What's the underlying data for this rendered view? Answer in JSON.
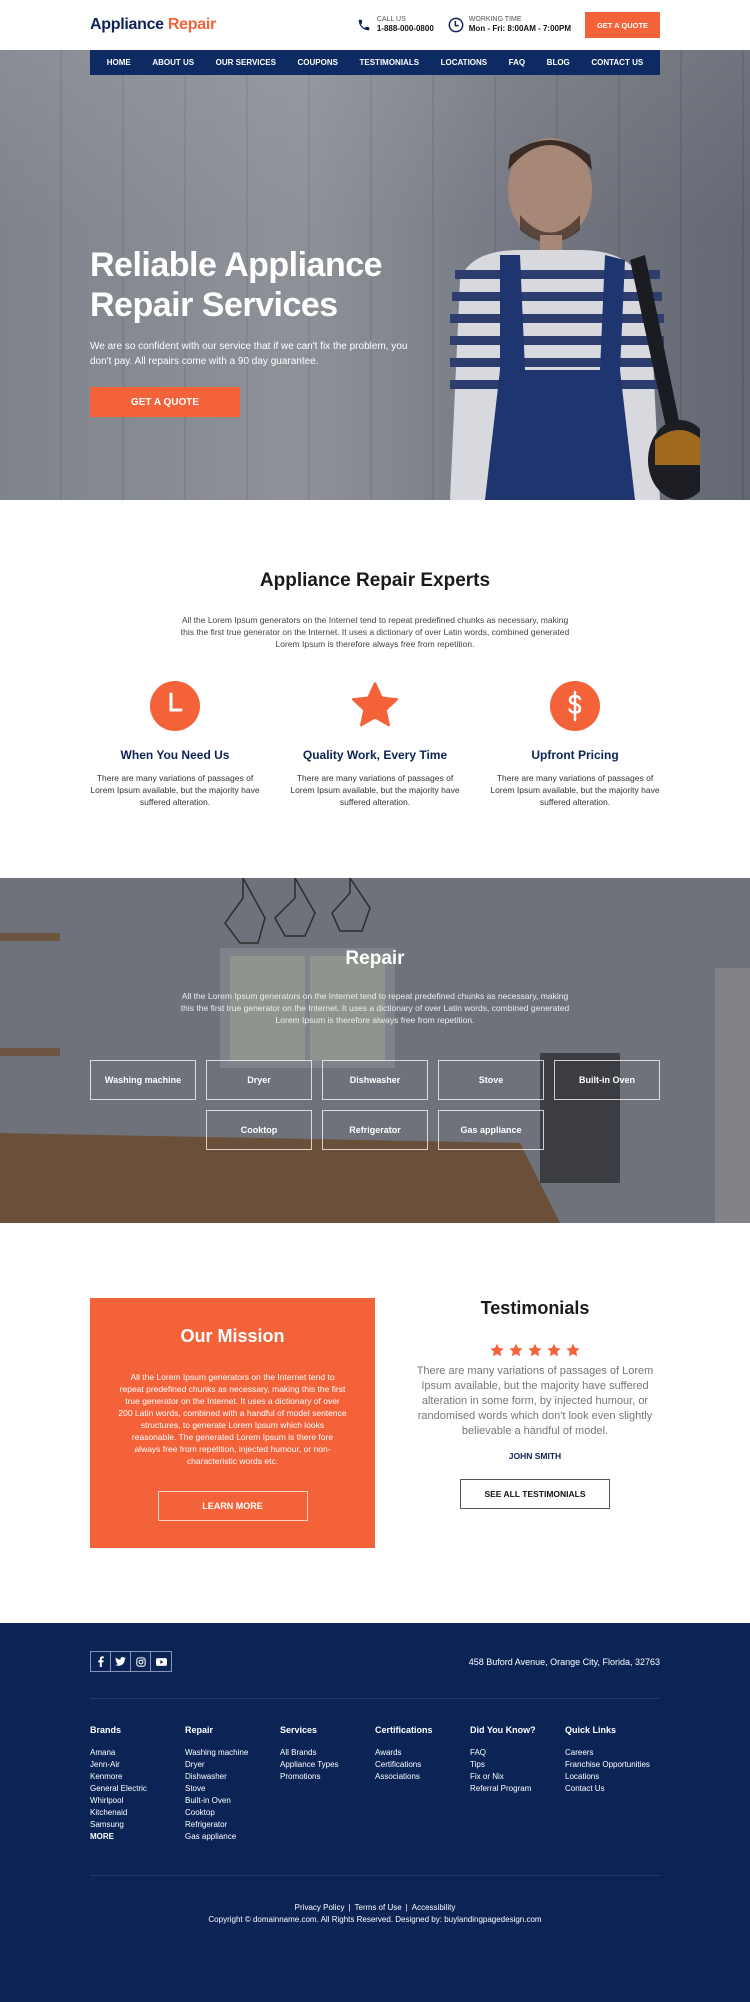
{
  "header": {
    "logo_part1": "Appliance",
    "logo_part2": "Repair",
    "call_label": "CALL US",
    "call_value": "1-888-000-0800",
    "hours_label": "WORKING TIME",
    "hours_value": "Mon - Fri: 8:00AM - 7:00PM",
    "quote_button": "GET A QUOTE"
  },
  "nav": [
    "HOME",
    "ABOUT US",
    "OUR SERVICES",
    "COUPONS",
    "TESTIMONIALS",
    "LOCATIONS",
    "FAQ",
    "BLOG",
    "CONTACT US"
  ],
  "hero": {
    "title_line1": "Reliable Appliance",
    "title_line2": "Repair Services",
    "subtitle": "We are so confident with our service that if we can't fix the problem, you don't pay. All repairs come with a 90 day guarantee.",
    "button": "GET A QUOTE"
  },
  "experts": {
    "title": "Appliance Repair Experts",
    "intro": "All the Lorem Ipsum generators on the Internet tend to repeat predefined chunks as necessary, making this the first true generator on the Internet. It uses a dictionary of over Latin words, combined generated Lorem Ipsum is therefore always free from repetition.",
    "features": [
      {
        "icon": "clock-icon",
        "title": "When You Need Us",
        "text": "There are many variations of passages of Lorem Ipsum available, but the majority have suffered alteration."
      },
      {
        "icon": "star-icon",
        "title": "Quality Work, Every Time",
        "text": "There are many variations of passages of Lorem Ipsum available, but the majority have suffered alteration."
      },
      {
        "icon": "dollar-icon",
        "title": "Upfront Pricing",
        "text": "There are many variations of passages of Lorem Ipsum available, but the majority have suffered alteration."
      }
    ]
  },
  "repair": {
    "title": "Repair",
    "intro": "All the Lorem Ipsum generators on the Internet tend to repeat predefined chunks as necessary, making this the first true generator on the Internet. It uses a dictionary of over Latin words, combined generated Lorem Ipsum is therefore always free from repetition.",
    "items": [
      "Washing machine",
      "Dryer",
      "Dishwasher",
      "Stove",
      "Built-in Oven",
      "Cooktop",
      "Refrigerator",
      "Gas appliance"
    ]
  },
  "mission": {
    "title": "Our Mission",
    "text": "All the Lorem Ipsum generators on the Internet tend to repeat predefined chunks as necessary, making this the first true generator on the Internet. It uses a dictionary of over 200 Latin words, combined with a handful of model sentence structures, to generate Lorem Ipsum which looks reasonable. The generated Lorem Ipsum is there fore always free from repetition, injected humour, or non-characteristic words etc.",
    "button": "LEARN MORE"
  },
  "testimonials": {
    "title": "Testimonials",
    "rating": 5,
    "rating_max": 5,
    "quote": "There are many variations of passages of Lorem Ipsum available, but the majority have suffered alteration in some form, by injected humour, or randomised words which don't look even slightly believable a handful of model.",
    "author": "JOHN SMITH",
    "button": "SEE ALL TESTIMONIALS"
  },
  "footer": {
    "social": [
      "facebook-icon",
      "twitter-icon",
      "instagram-icon",
      "youtube-icon"
    ],
    "address": "458 Buford Avenue, Orange City, Florida, 32763",
    "columns": [
      {
        "title": "Brands",
        "links": [
          "Amana",
          "Jenn-Air",
          "Kenmore",
          "General Electric",
          "Whirlpool",
          "Kitchenaid",
          "Samsung"
        ],
        "more": "MORE"
      },
      {
        "title": "Repair",
        "links": [
          "Washing machine",
          "Dryer",
          "Dishwasher",
          "Stove",
          "Built-in Oven",
          "Cooktop",
          "Refrigerator",
          "Gas appliance"
        ]
      },
      {
        "title": "Services",
        "links": [
          "All Brands",
          "Appliance Types",
          "Promotions"
        ]
      },
      {
        "title": "Certifications",
        "links": [
          "Awards",
          "Certifications",
          "Associations"
        ]
      },
      {
        "title": "Did You Know?",
        "links": [
          "FAQ",
          "Tips",
          "Fix or Nix",
          "Referral Program"
        ]
      },
      {
        "title": "Quick Links",
        "links": [
          "Careers",
          "Franchise Opportunities",
          "Locations",
          "Contact Us"
        ]
      }
    ],
    "legal_links": [
      "Privacy Policy",
      "Terms of Use",
      "Accessibility"
    ],
    "copyright": "Copyright © domainname.com. All Rights Reserved. Designed by: buylandingpagedesign.com"
  },
  "colors": {
    "accent": "#f4623a",
    "navy": "#0d2a63",
    "footer_bg": "#0b2455"
  }
}
